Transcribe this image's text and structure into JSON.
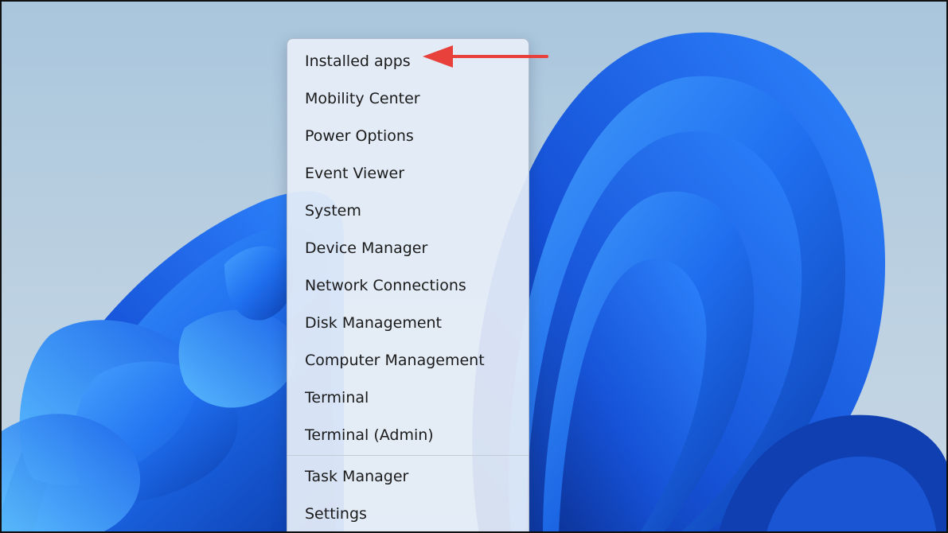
{
  "context_menu": {
    "items": [
      {
        "label": "Installed apps"
      },
      {
        "label": "Mobility Center"
      },
      {
        "label": "Power Options"
      },
      {
        "label": "Event Viewer"
      },
      {
        "label": "System"
      },
      {
        "label": "Device Manager"
      },
      {
        "label": "Network Connections"
      },
      {
        "label": "Disk Management"
      },
      {
        "label": "Computer Management"
      },
      {
        "label": "Terminal"
      },
      {
        "label": "Terminal (Admin)"
      },
      {
        "label": "Task Manager"
      },
      {
        "label": "Settings"
      }
    ]
  },
  "colors": {
    "arrow": "#e8403a",
    "bloom_primary": "#1f5fe0",
    "bloom_light": "#3a92ff",
    "bloom_dark": "#0d3fb3"
  },
  "icons": {
    "annotation": "red-arrow-icon",
    "background": "windows-bloom-wallpaper"
  }
}
